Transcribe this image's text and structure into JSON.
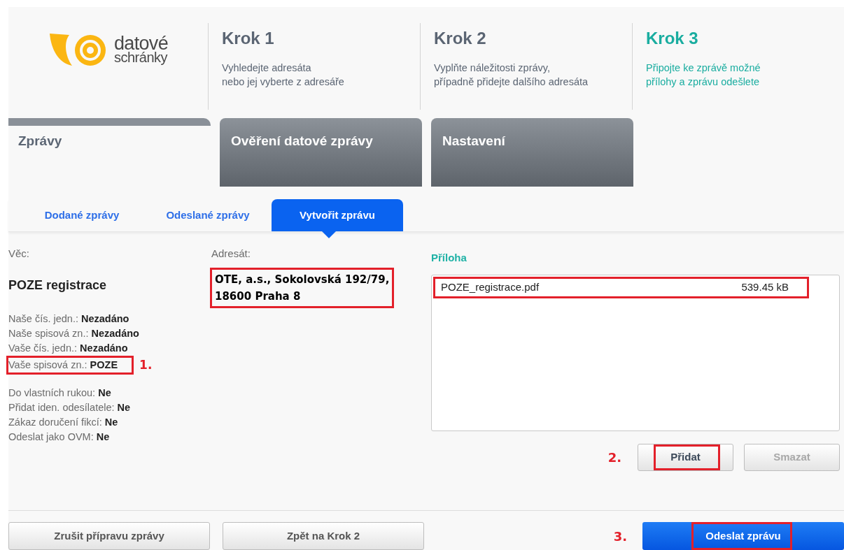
{
  "logo": {
    "line_1": "datové",
    "line_2": "schránky"
  },
  "steps": [
    {
      "title": "Krok 1",
      "description": [
        "Vyhledejte adresáta",
        "nebo jej vyberte z adresáře"
      ],
      "selected": false
    },
    {
      "title": "Krok 2",
      "description": [
        "Vyplňte náležitosti zprávy,",
        "případně přidejte dalšího adresáta"
      ],
      "selected": false
    },
    {
      "title": "Krok 3",
      "description": [
        "Připojte ke zprávě možné",
        "přílohy a zprávu odešlete"
      ],
      "selected": true
    }
  ],
  "main_tabs": [
    {
      "label": "Zprávy",
      "selected": true
    },
    {
      "label": "Ověření datové zprávy",
      "selected": false
    },
    {
      "label": "Nastavení",
      "selected": false
    }
  ],
  "sub_tabs": [
    {
      "label": "Dodané zprávy",
      "selected": false
    },
    {
      "label": "Odeslané zprávy",
      "selected": false
    },
    {
      "label": "Vytvořit zprávu",
      "selected": true
    }
  ],
  "subject": {
    "label": "Věc:",
    "value": "POZE registrace"
  },
  "reference_fields": [
    {
      "label": "Naše čís. jedn.:",
      "value": "Nezadáno",
      "highlighted": false
    },
    {
      "label": "Naše spisová zn.:",
      "value": "Nezadáno",
      "highlighted": false
    },
    {
      "label": "Vaše čís. jedn.:",
      "value": "Nezadáno",
      "highlighted": false
    },
    {
      "label": "Vaše spisová zn.:",
      "value": "POZE",
      "highlighted": true,
      "marker": "1."
    }
  ],
  "delivery_options": [
    {
      "label": "Do vlastních rukou:",
      "value": "Ne"
    },
    {
      "label": "Přidat iden. odesílatele:",
      "value": "Ne"
    },
    {
      "label": "Zákaz doručení fikcí:",
      "value": "Ne"
    },
    {
      "label": "Odeslat jako OVM:",
      "value": "Ne"
    }
  ],
  "recipient": {
    "label": "Adresát:",
    "lines": [
      "OTE, a.s., Sokolovská 192/79,",
      "18600 Praha 8"
    ],
    "highlighted": true
  },
  "attachments": {
    "title": "Příloha",
    "files": [
      {
        "name": "POZE_registrace.pdf",
        "size": "539.45 kB",
        "highlighted": true
      }
    ]
  },
  "attachment_buttons": [
    {
      "label": "Přidat",
      "disabled": false,
      "highlighted": true,
      "marker": "2."
    },
    {
      "label": "Smazat",
      "disabled": true,
      "highlighted": false
    }
  ],
  "footer_buttons": [
    {
      "label": "Zrušit přípravu zprávy",
      "kind": "secondary",
      "highlighted": false
    },
    {
      "label": "Zpět na Krok 2",
      "kind": "secondary",
      "highlighted": false
    },
    {
      "label": "Odeslat zprávu",
      "kind": "primary",
      "highlighted": true,
      "marker": "3."
    }
  ]
}
